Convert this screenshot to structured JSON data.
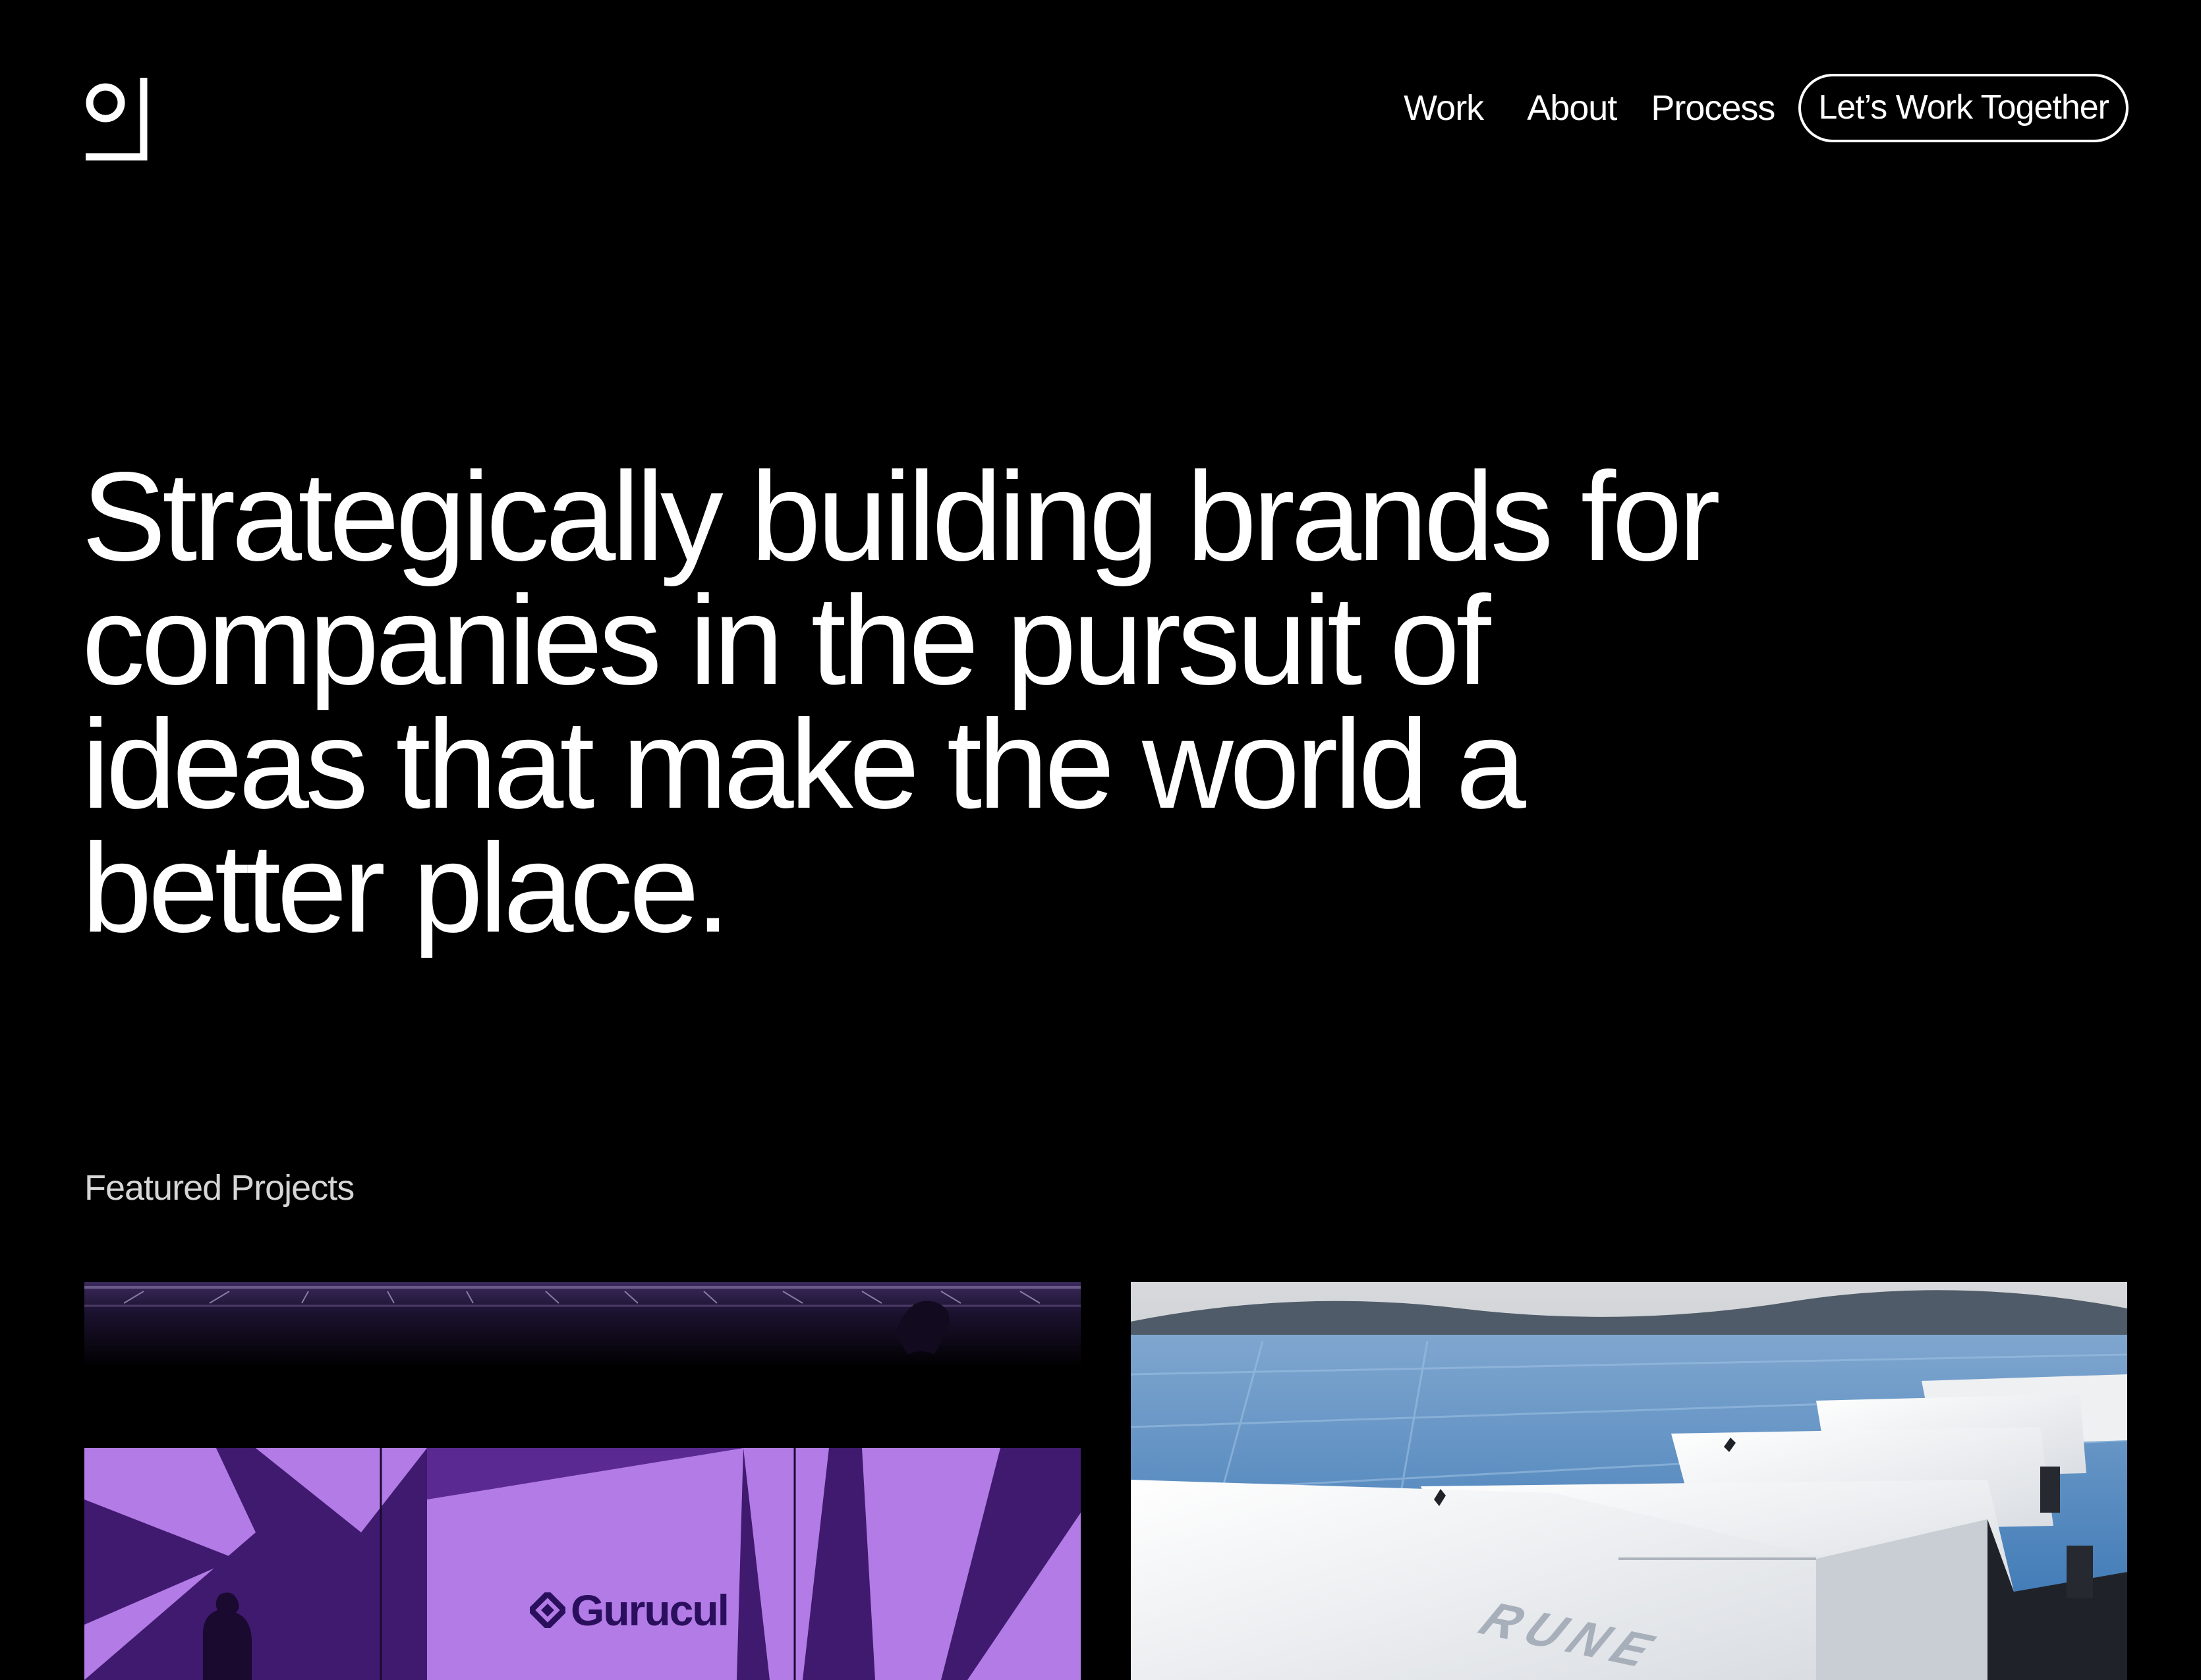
{
  "brand": {
    "logo_icon": "studio-monogram-logo"
  },
  "nav": {
    "links": [
      {
        "label": "Work"
      },
      {
        "label": "About"
      },
      {
        "label": "Process"
      }
    ],
    "cta_label": "Let’s Work Together"
  },
  "hero": {
    "lines": [
      "Strategically building brands for",
      "companies in the pursuit of",
      "ideas that make the world a",
      "better place."
    ]
  },
  "featured": {
    "label": "Featured Projects",
    "projects": [
      {
        "name": "Gurucul",
        "image": "purple-stage-event-photo"
      },
      {
        "name": "RUNE",
        "image": "solar-battery-units-photo"
      }
    ]
  },
  "colors": {
    "background": "#000000",
    "text": "#ffffff",
    "muted_text": "#d6d6d6",
    "gurucul_purple": "#b27be6",
    "gurucul_dark": "#2a0f5c"
  }
}
